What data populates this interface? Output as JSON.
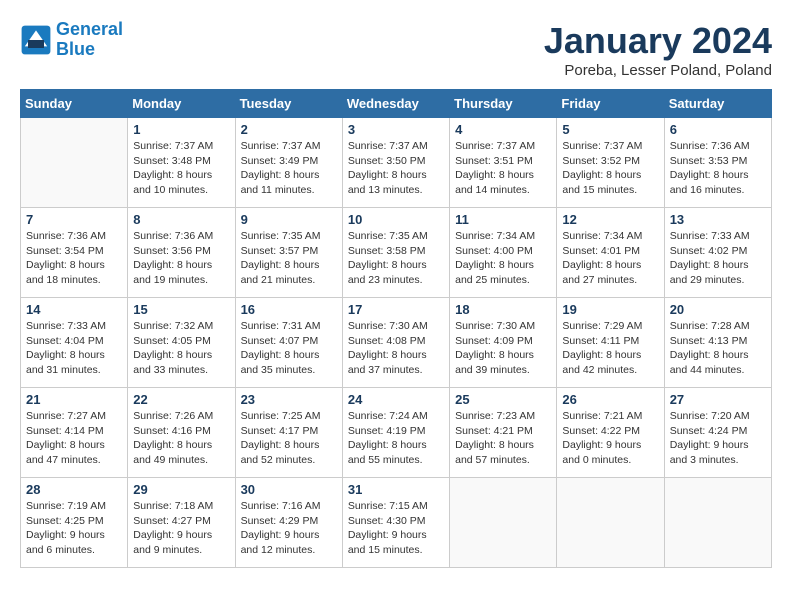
{
  "header": {
    "logo_line1": "General",
    "logo_line2": "Blue",
    "month_title": "January 2024",
    "location": "Poreba, Lesser Poland, Poland"
  },
  "weekdays": [
    "Sunday",
    "Monday",
    "Tuesday",
    "Wednesday",
    "Thursday",
    "Friday",
    "Saturday"
  ],
  "weeks": [
    [
      {
        "day": "",
        "info": ""
      },
      {
        "day": "1",
        "info": "Sunrise: 7:37 AM\nSunset: 3:48 PM\nDaylight: 8 hours\nand 10 minutes."
      },
      {
        "day": "2",
        "info": "Sunrise: 7:37 AM\nSunset: 3:49 PM\nDaylight: 8 hours\nand 11 minutes."
      },
      {
        "day": "3",
        "info": "Sunrise: 7:37 AM\nSunset: 3:50 PM\nDaylight: 8 hours\nand 13 minutes."
      },
      {
        "day": "4",
        "info": "Sunrise: 7:37 AM\nSunset: 3:51 PM\nDaylight: 8 hours\nand 14 minutes."
      },
      {
        "day": "5",
        "info": "Sunrise: 7:37 AM\nSunset: 3:52 PM\nDaylight: 8 hours\nand 15 minutes."
      },
      {
        "day": "6",
        "info": "Sunrise: 7:36 AM\nSunset: 3:53 PM\nDaylight: 8 hours\nand 16 minutes."
      }
    ],
    [
      {
        "day": "7",
        "info": "Sunrise: 7:36 AM\nSunset: 3:54 PM\nDaylight: 8 hours\nand 18 minutes."
      },
      {
        "day": "8",
        "info": "Sunrise: 7:36 AM\nSunset: 3:56 PM\nDaylight: 8 hours\nand 19 minutes."
      },
      {
        "day": "9",
        "info": "Sunrise: 7:35 AM\nSunset: 3:57 PM\nDaylight: 8 hours\nand 21 minutes."
      },
      {
        "day": "10",
        "info": "Sunrise: 7:35 AM\nSunset: 3:58 PM\nDaylight: 8 hours\nand 23 minutes."
      },
      {
        "day": "11",
        "info": "Sunrise: 7:34 AM\nSunset: 4:00 PM\nDaylight: 8 hours\nand 25 minutes."
      },
      {
        "day": "12",
        "info": "Sunrise: 7:34 AM\nSunset: 4:01 PM\nDaylight: 8 hours\nand 27 minutes."
      },
      {
        "day": "13",
        "info": "Sunrise: 7:33 AM\nSunset: 4:02 PM\nDaylight: 8 hours\nand 29 minutes."
      }
    ],
    [
      {
        "day": "14",
        "info": "Sunrise: 7:33 AM\nSunset: 4:04 PM\nDaylight: 8 hours\nand 31 minutes."
      },
      {
        "day": "15",
        "info": "Sunrise: 7:32 AM\nSunset: 4:05 PM\nDaylight: 8 hours\nand 33 minutes."
      },
      {
        "day": "16",
        "info": "Sunrise: 7:31 AM\nSunset: 4:07 PM\nDaylight: 8 hours\nand 35 minutes."
      },
      {
        "day": "17",
        "info": "Sunrise: 7:30 AM\nSunset: 4:08 PM\nDaylight: 8 hours\nand 37 minutes."
      },
      {
        "day": "18",
        "info": "Sunrise: 7:30 AM\nSunset: 4:09 PM\nDaylight: 8 hours\nand 39 minutes."
      },
      {
        "day": "19",
        "info": "Sunrise: 7:29 AM\nSunset: 4:11 PM\nDaylight: 8 hours\nand 42 minutes."
      },
      {
        "day": "20",
        "info": "Sunrise: 7:28 AM\nSunset: 4:13 PM\nDaylight: 8 hours\nand 44 minutes."
      }
    ],
    [
      {
        "day": "21",
        "info": "Sunrise: 7:27 AM\nSunset: 4:14 PM\nDaylight: 8 hours\nand 47 minutes."
      },
      {
        "day": "22",
        "info": "Sunrise: 7:26 AM\nSunset: 4:16 PM\nDaylight: 8 hours\nand 49 minutes."
      },
      {
        "day": "23",
        "info": "Sunrise: 7:25 AM\nSunset: 4:17 PM\nDaylight: 8 hours\nand 52 minutes."
      },
      {
        "day": "24",
        "info": "Sunrise: 7:24 AM\nSunset: 4:19 PM\nDaylight: 8 hours\nand 55 minutes."
      },
      {
        "day": "25",
        "info": "Sunrise: 7:23 AM\nSunset: 4:21 PM\nDaylight: 8 hours\nand 57 minutes."
      },
      {
        "day": "26",
        "info": "Sunrise: 7:21 AM\nSunset: 4:22 PM\nDaylight: 9 hours\nand 0 minutes."
      },
      {
        "day": "27",
        "info": "Sunrise: 7:20 AM\nSunset: 4:24 PM\nDaylight: 9 hours\nand 3 minutes."
      }
    ],
    [
      {
        "day": "28",
        "info": "Sunrise: 7:19 AM\nSunset: 4:25 PM\nDaylight: 9 hours\nand 6 minutes."
      },
      {
        "day": "29",
        "info": "Sunrise: 7:18 AM\nSunset: 4:27 PM\nDaylight: 9 hours\nand 9 minutes."
      },
      {
        "day": "30",
        "info": "Sunrise: 7:16 AM\nSunset: 4:29 PM\nDaylight: 9 hours\nand 12 minutes."
      },
      {
        "day": "31",
        "info": "Sunrise: 7:15 AM\nSunset: 4:30 PM\nDaylight: 9 hours\nand 15 minutes."
      },
      {
        "day": "",
        "info": ""
      },
      {
        "day": "",
        "info": ""
      },
      {
        "day": "",
        "info": ""
      }
    ]
  ]
}
